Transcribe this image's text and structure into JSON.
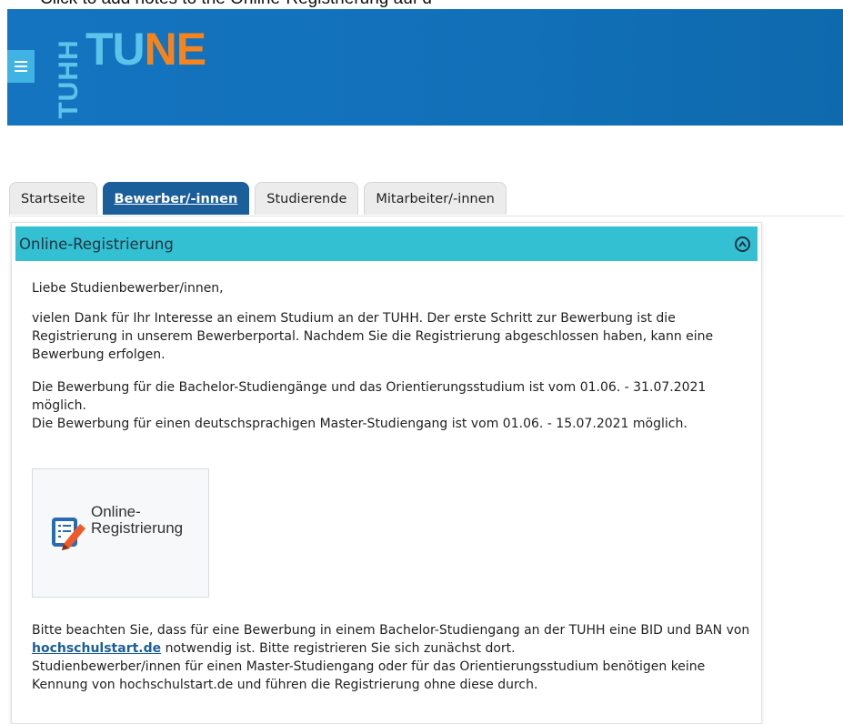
{
  "caption": "Click to add notes to the Online-Registrierung auf d",
  "header": {
    "logo_side": "TUHH",
    "logo_tu": "TU",
    "logo_ne": "NE"
  },
  "tabs": [
    {
      "label": "Startseite",
      "active": false
    },
    {
      "label": "Bewerber/-innen",
      "active": true
    },
    {
      "label": "Studierende",
      "active": false
    },
    {
      "label": "Mitarbeiter/-innen",
      "active": false
    }
  ],
  "panel": {
    "title": "Online-Registrierung",
    "greeting": "Liebe Studienbewerber/innen,",
    "para1": "vielen Dank für Ihr Interesse an einem Studium an der TUHH. Der erste Schritt zur Bewerbung ist die Registrierung in unserem Bewerberportal. Nachdem Sie die Registrierung abgeschlossen haben, kann eine Bewerbung erfolgen.",
    "para2_line1": "Die Bewerbung für die Bachelor-Studiengänge und das Orientierungsstudium ist vom 01.06. - 31.07.2021 möglich.",
    "para2_line2": "Die Bewerbung für einen deutschsprachigen Master-Studiengang ist vom 01.06. - 15.07.2021 möglich.",
    "tile_label_1": "Online-",
    "tile_label_2": "Registrierung",
    "bottom_1": "Bitte beachten Sie, dass für eine Bewerbung in einem Bachelor-Studiengang an der TUHH eine BID und BAN von",
    "bottom_link": "hochschulstart.de",
    "bottom_2": "notwendig ist. Bitte registrieren Sie sich zunächst dort.",
    "bottom_3": "Studienbewerber/innen für einen Master-Studiengang oder für das Orientierungsstudium benötigen keine Kennung von hochschulstart.de und führen die Registrierung ohne diese durch."
  },
  "colors": {
    "header_blue": "#1574c0",
    "tab_active": "#1a5e9a",
    "panel_header": "#33c0d2",
    "logo_light_blue": "#5cc3ea",
    "logo_orange": "#f5841f"
  },
  "icons": {
    "menu": "hamburger-icon",
    "collapse": "chevron-up-circle-icon",
    "tile": "edit-document-icon"
  }
}
